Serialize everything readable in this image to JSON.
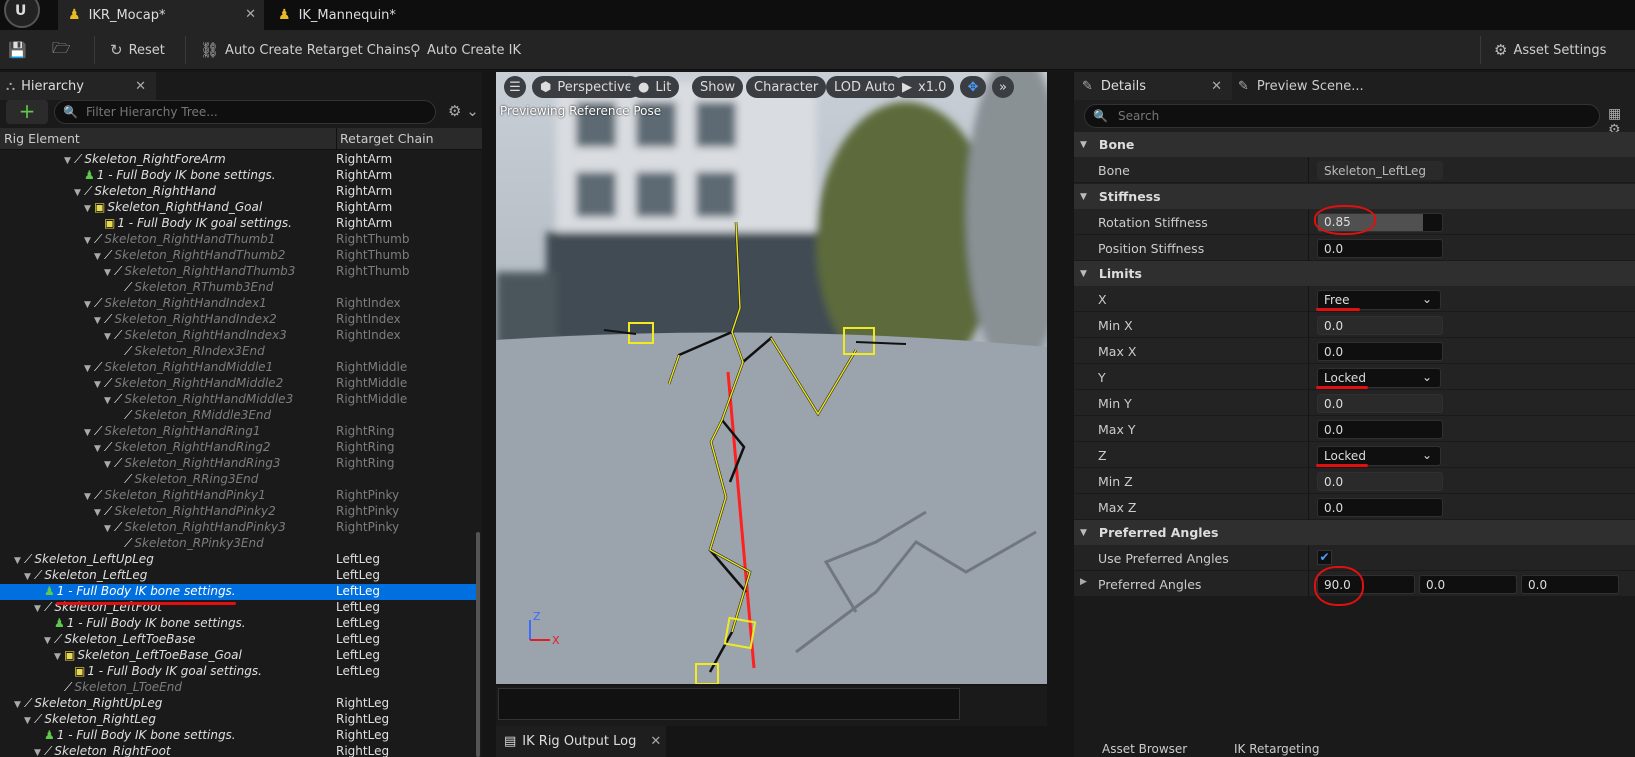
{
  "tabs": [
    {
      "label": "IKR_Mocap*",
      "icon": "ik-rig-icon"
    },
    {
      "label": "IK_Mannequin*",
      "icon": "ik-rig-icon"
    }
  ],
  "toolbar": {
    "reset": "Reset",
    "auto_chains": "Auto Create Retarget Chains",
    "auto_ik": "Auto Create IK",
    "asset_settings": "Asset Settings"
  },
  "hierarchy": {
    "tab_label": "Hierarchy",
    "filter_placeholder": "Filter Hierarchy Tree...",
    "col_element": "Rig Element",
    "col_chain": "Retarget Chain",
    "rows": [
      {
        "name": "Skeleton_RightForeArm",
        "chain": "RightArm",
        "type": "bone",
        "depth": 6,
        "arrow": true,
        "dim": false
      },
      {
        "name": "1 - Full Body IK bone settings.",
        "chain": "RightArm",
        "type": "ik",
        "depth": 7,
        "arrow": false,
        "dim": false
      },
      {
        "name": "Skeleton_RightHand",
        "chain": "RightArm",
        "type": "bone",
        "depth": 7,
        "arrow": true,
        "dim": false
      },
      {
        "name": "Skeleton_RightHand_Goal",
        "chain": "RightArm",
        "type": "goal",
        "depth": 8,
        "arrow": true,
        "dim": false
      },
      {
        "name": "1 - Full Body IK goal settings.",
        "chain": "RightArm",
        "type": "goalset",
        "depth": 9,
        "arrow": false,
        "dim": false
      },
      {
        "name": "Skeleton_RightHandThumb1",
        "chain": "RightThumb",
        "type": "bone",
        "depth": 8,
        "arrow": true,
        "dim": true
      },
      {
        "name": "Skeleton_RightHandThumb2",
        "chain": "RightThumb",
        "type": "bone",
        "depth": 9,
        "arrow": true,
        "dim": true
      },
      {
        "name": "Skeleton_RightHandThumb3",
        "chain": "RightThumb",
        "type": "bone",
        "depth": 10,
        "arrow": true,
        "dim": true
      },
      {
        "name": "Skeleton_RThumb3End",
        "chain": "",
        "type": "bone",
        "depth": 11,
        "arrow": false,
        "dim": true
      },
      {
        "name": "Skeleton_RightHandIndex1",
        "chain": "RightIndex",
        "type": "bone",
        "depth": 8,
        "arrow": true,
        "dim": true
      },
      {
        "name": "Skeleton_RightHandIndex2",
        "chain": "RightIndex",
        "type": "bone",
        "depth": 9,
        "arrow": true,
        "dim": true
      },
      {
        "name": "Skeleton_RightHandIndex3",
        "chain": "RightIndex",
        "type": "bone",
        "depth": 10,
        "arrow": true,
        "dim": true
      },
      {
        "name": "Skeleton_RIndex3End",
        "chain": "",
        "type": "bone",
        "depth": 11,
        "arrow": false,
        "dim": true
      },
      {
        "name": "Skeleton_RightHandMiddle1",
        "chain": "RightMiddle",
        "type": "bone",
        "depth": 8,
        "arrow": true,
        "dim": true
      },
      {
        "name": "Skeleton_RightHandMiddle2",
        "chain": "RightMiddle",
        "type": "bone",
        "depth": 9,
        "arrow": true,
        "dim": true
      },
      {
        "name": "Skeleton_RightHandMiddle3",
        "chain": "RightMiddle",
        "type": "bone",
        "depth": 10,
        "arrow": true,
        "dim": true
      },
      {
        "name": "Skeleton_RMiddle3End",
        "chain": "",
        "type": "bone",
        "depth": 11,
        "arrow": false,
        "dim": true
      },
      {
        "name": "Skeleton_RightHandRing1",
        "chain": "RightRing",
        "type": "bone",
        "depth": 8,
        "arrow": true,
        "dim": true
      },
      {
        "name": "Skeleton_RightHandRing2",
        "chain": "RightRing",
        "type": "bone",
        "depth": 9,
        "arrow": true,
        "dim": true
      },
      {
        "name": "Skeleton_RightHandRing3",
        "chain": "RightRing",
        "type": "bone",
        "depth": 10,
        "arrow": true,
        "dim": true
      },
      {
        "name": "Skeleton_RRing3End",
        "chain": "",
        "type": "bone",
        "depth": 11,
        "arrow": false,
        "dim": true
      },
      {
        "name": "Skeleton_RightHandPinky1",
        "chain": "RightPinky",
        "type": "bone",
        "depth": 8,
        "arrow": true,
        "dim": true
      },
      {
        "name": "Skeleton_RightHandPinky2",
        "chain": "RightPinky",
        "type": "bone",
        "depth": 9,
        "arrow": true,
        "dim": true
      },
      {
        "name": "Skeleton_RightHandPinky3",
        "chain": "RightPinky",
        "type": "bone",
        "depth": 10,
        "arrow": true,
        "dim": true
      },
      {
        "name": "Skeleton_RPinky3End",
        "chain": "",
        "type": "bone",
        "depth": 11,
        "arrow": false,
        "dim": true
      },
      {
        "name": "Skeleton_LeftUpLeg",
        "chain": "LeftLeg",
        "type": "bone",
        "depth": 1,
        "arrow": true,
        "dim": false
      },
      {
        "name": "Skeleton_LeftLeg",
        "chain": "LeftLeg",
        "type": "bone",
        "depth": 2,
        "arrow": true,
        "dim": false
      },
      {
        "name": "1 - Full Body IK bone settings.",
        "chain": "LeftLeg",
        "type": "ik",
        "depth": 3,
        "arrow": false,
        "dim": false,
        "selected": true
      },
      {
        "name": "Skeleton_LeftFoot",
        "chain": "LeftLeg",
        "type": "bone",
        "depth": 3,
        "arrow": true,
        "dim": false
      },
      {
        "name": "1 - Full Body IK bone settings.",
        "chain": "LeftLeg",
        "type": "ik",
        "depth": 4,
        "arrow": false,
        "dim": false
      },
      {
        "name": "Skeleton_LeftToeBase",
        "chain": "LeftLeg",
        "type": "bone",
        "depth": 4,
        "arrow": true,
        "dim": false
      },
      {
        "name": "Skeleton_LeftToeBase_Goal",
        "chain": "LeftLeg",
        "type": "goal",
        "depth": 5,
        "arrow": true,
        "dim": false
      },
      {
        "name": "1 - Full Body IK goal settings.",
        "chain": "LeftLeg",
        "type": "goalset",
        "depth": 6,
        "arrow": false,
        "dim": false
      },
      {
        "name": "Skeleton_LToeEnd",
        "chain": "",
        "type": "bone",
        "depth": 5,
        "arrow": false,
        "dim": true
      },
      {
        "name": "Skeleton_RightUpLeg",
        "chain": "RightLeg",
        "type": "bone",
        "depth": 1,
        "arrow": true,
        "dim": false
      },
      {
        "name": "Skeleton_RightLeg",
        "chain": "RightLeg",
        "type": "bone",
        "depth": 2,
        "arrow": true,
        "dim": false
      },
      {
        "name": "1 - Full Body IK bone settings.",
        "chain": "RightLeg",
        "type": "ik",
        "depth": 3,
        "arrow": false,
        "dim": false
      },
      {
        "name": "Skeleton_RightFoot",
        "chain": "RightLeg",
        "type": "bone",
        "depth": 3,
        "arrow": true,
        "dim": false
      }
    ]
  },
  "viewport": {
    "perspective": "Perspective",
    "lit": "Lit",
    "show": "Show",
    "character": "Character",
    "lod": "LOD Auto",
    "speed": "x1.0",
    "status": "Previewing Reference Pose",
    "axis_x": "X",
    "axis_z": "Z"
  },
  "output_log": {
    "tab": "IK Rig Output Log"
  },
  "details": {
    "tab": "Details",
    "preview_tab": "Preview Scene...",
    "search_placeholder": "Search",
    "bone_cat": "Bone",
    "bone_label": "Bone",
    "bone_value": "Skeleton_LeftLeg",
    "stiffness_cat": "Stiffness",
    "rot_stiff_label": "Rotation Stiffness",
    "rot_stiff": "0.85",
    "rot_stiff_fraction": 0.85,
    "pos_stiff_label": "Position Stiffness",
    "pos_stiff": "0.0",
    "limits_cat": "Limits",
    "x_label": "X",
    "x_value": "Free",
    "minx_label": "Min X",
    "minx": "0.0",
    "maxx_label": "Max X",
    "maxx": "0.0",
    "y_label": "Y",
    "y_value": "Locked",
    "miny_label": "Min Y",
    "miny": "0.0",
    "maxy_label": "Max Y",
    "maxy": "0.0",
    "z_label": "Z",
    "z_value": "Locked",
    "minz_label": "Min Z",
    "minz": "0.0",
    "maxz_label": "Max Z",
    "maxz": "0.0",
    "pref_cat": "Preferred Angles",
    "use_pref_label": "Use Preferred Angles",
    "use_pref": true,
    "pref_label": "Preferred Angles",
    "pref_x": "90.0",
    "pref_y": "0.0",
    "pref_z": "0.0"
  },
  "bottom_tabs": {
    "asset_browser": "Asset Browser",
    "retargeting": "IK Retargeting"
  },
  "colors": {
    "selection": "#0070e0",
    "annotation": "#e01010",
    "ik_icon": "#5ec94a",
    "goal_icon": "#e8d84a"
  }
}
